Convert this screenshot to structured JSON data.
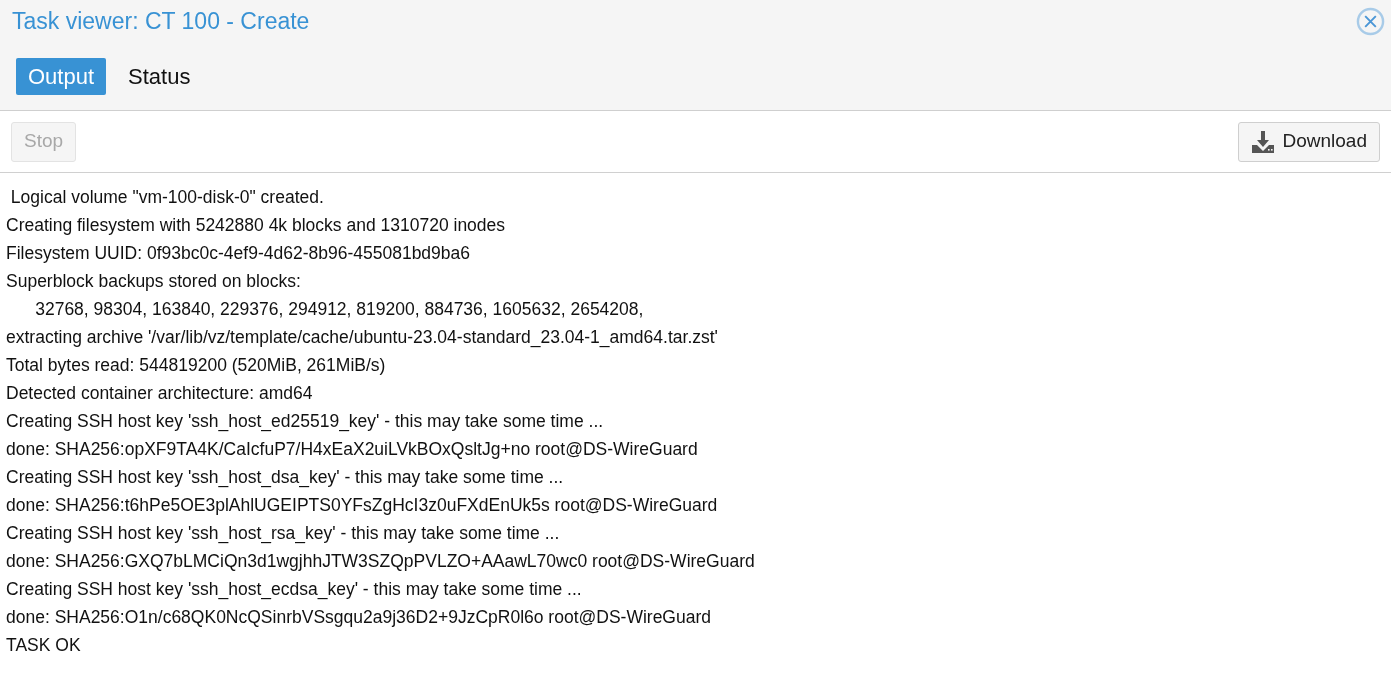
{
  "window": {
    "title": "Task viewer: CT 100 - Create"
  },
  "tabs": [
    {
      "label": "Output",
      "selected": true
    },
    {
      "label": "Status",
      "selected": false
    }
  ],
  "toolbar": {
    "stop": {
      "label": "Stop",
      "disabled": true
    },
    "download": {
      "label": "Download",
      "disabled": false
    }
  },
  "log": [
    " Logical volume \"vm-100-disk-0\" created.",
    "Creating filesystem with 5242880 4k blocks and 1310720 inodes",
    "Filesystem UUID: 0f93bc0c-4ef9-4d62-8b96-455081bd9ba6",
    "Superblock backups stored on blocks:",
    "\t32768, 98304, 163840, 229376, 294912, 819200, 884736, 1605632, 2654208,",
    "extracting archive '/var/lib/vz/template/cache/ubuntu-23.04-standard_23.04-1_amd64.tar.zst'",
    "Total bytes read: 544819200 (520MiB, 261MiB/s)",
    "Detected container architecture: amd64",
    "Creating SSH host key 'ssh_host_ed25519_key' - this may take some time ...",
    "done: SHA256:opXF9TA4K/CaIcfuP7/H4xEaX2uiLVkBOxQsltJg+no root@DS-WireGuard",
    "Creating SSH host key 'ssh_host_dsa_key' - this may take some time ...",
    "done: SHA256:t6hPe5OE3plAhlUGEIPTS0YFsZgHcI3z0uFXdEnUk5s root@DS-WireGuard",
    "Creating SSH host key 'ssh_host_rsa_key' - this may take some time ...",
    "done: SHA256:GXQ7bLMCiQn3d1wgjhhJTW3SZQpPVLZO+AAawL70wc0 root@DS-WireGuard",
    "Creating SSH host key 'ssh_host_ecdsa_key' - this may take some time ...",
    "done: SHA256:O1n/c68QK0NcQSinrbVSsgqu2a9j36D2+9JzCpR0l6o root@DS-WireGuard",
    "TASK OK"
  ]
}
